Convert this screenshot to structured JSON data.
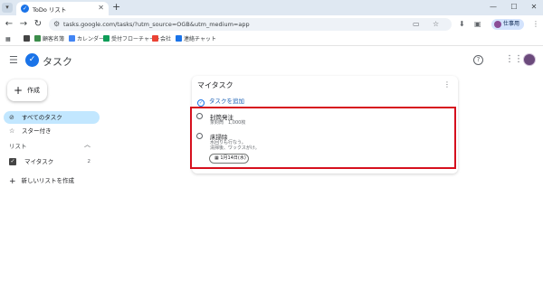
{
  "browser": {
    "tab_title": "ToDo リスト",
    "url": "tasks.google.com/tasks/?utm_source=OGB&utm_medium=app",
    "profile_label": "仕事用",
    "bookmarks": [
      {
        "label": "",
        "color": "#444444"
      },
      {
        "label": "顧客名簿",
        "color": "#3c8d4b"
      },
      {
        "label": "カレンダー",
        "color": "#4285f4"
      },
      {
        "label": "受付フローチャート",
        "color": "#0f9d58"
      },
      {
        "label": "会社",
        "color": "#ea4335"
      },
      {
        "label": "連絡チャット",
        "color": "#1a73e8"
      }
    ],
    "icons": {
      "tab_menu": "chevron-down-icon",
      "tab_close": "close-icon",
      "new_tab": "plus-icon",
      "back": "back-arrow-icon",
      "forward": "forward-arrow-icon",
      "reload": "reload-icon",
      "site_info": "site-info-icon",
      "cast": "cast-icon",
      "star": "star-icon",
      "download": "download-icon",
      "more": "more-vert-icon",
      "apps_grid": "apps-grid-icon"
    }
  },
  "app": {
    "title": "タスク",
    "create_label": "作成",
    "nav": {
      "all_tasks": "すべてのタスク",
      "starred": "スター付き"
    },
    "lists_heading": "リスト",
    "lists": [
      {
        "label": "マイタスク",
        "count": "2",
        "checked": true
      }
    ],
    "new_list": "新しいリストを作成"
  },
  "card": {
    "title": "マイタスク",
    "add_task": "タスクを追加",
    "tasks": [
      {
        "title": "封筒発注",
        "notes": [
          "茶封筒　1,000枚"
        ]
      },
      {
        "title": "床掃除",
        "notes": [
          "水回りも行なう。",
          "清掃後、ワックスがけ。"
        ],
        "date": "1月14日(水)"
      }
    ]
  },
  "colors": {
    "accent": "#1a73e8",
    "active_nav": "#c2e7ff",
    "highlight_box": "#d6101e"
  }
}
